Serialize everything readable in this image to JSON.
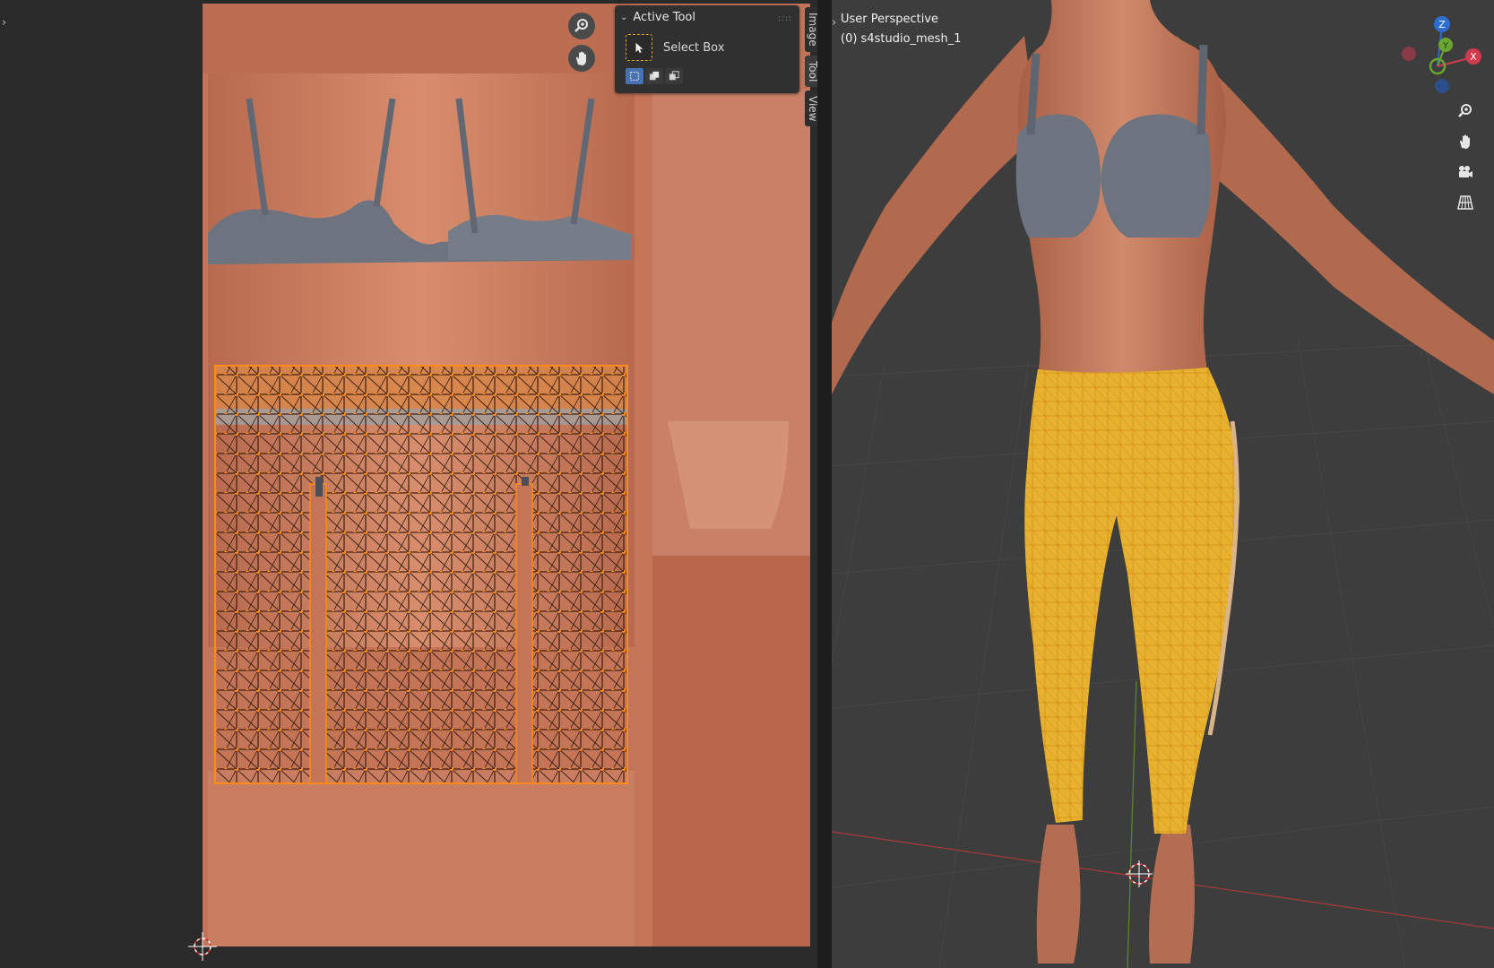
{
  "uv_editor": {
    "active_tool_panel": {
      "header": "Active Tool",
      "tool_name": "Select Box"
    },
    "side_tabs": [
      {
        "label": "Image"
      },
      {
        "label": "Tool"
      },
      {
        "label": "View"
      }
    ],
    "nav_icons": [
      "zoom-icon",
      "hand-pan-icon"
    ]
  },
  "viewport": {
    "view_name": "User Perspective",
    "object_name": "(0) s4studio_mesh_1",
    "gizmo_axes": [
      "Z",
      "Y",
      "X"
    ],
    "nav_icons": [
      "zoom-icon",
      "hand-pan-icon",
      "camera-icon",
      "grid-icon"
    ]
  },
  "colors": {
    "skin": "#c9775a",
    "bra": "#6d7480",
    "uv_wire": "#ff8a1a",
    "leggings": "#e8b22e",
    "viewport_bg": "#3d3d3d",
    "accent_blue": "#4772b3"
  }
}
